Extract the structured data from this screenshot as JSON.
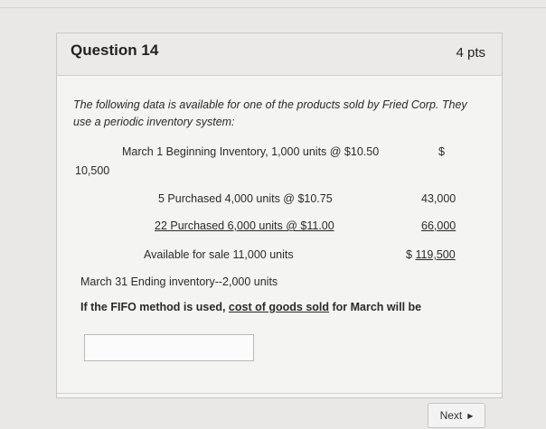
{
  "question": {
    "title": "Question 14",
    "points": "4 pts",
    "intro_line1": "The following data is available for one of the products sold by Fried Corp. They",
    "intro_line2": "use a periodic inventory system:",
    "row1_label": "March  1  Beginning Inventory, 1,000 units @ $10.50",
    "row1_dollar": "$",
    "row1_value": "10,500",
    "row2_label": "5  Purchased 4,000 units @ $10.75",
    "row2_value": "43,000",
    "row3_label": "22  Purchased 6,000 units @ $11.00",
    "row3_value": "66,000",
    "row4_label": "Available for sale 11,000 units",
    "row4_dollar": "$ ",
    "row4_value": "119,500",
    "ending_line": "March 31 Ending inventory--2,000 units",
    "prompt_pre": "If the FIFO method is used, ",
    "prompt_link": "cost of goods sold",
    "prompt_post": " for March will be",
    "answer_value": ""
  },
  "footer": {
    "next_label": "Next",
    "next_icon": "play-triangle-icon"
  }
}
